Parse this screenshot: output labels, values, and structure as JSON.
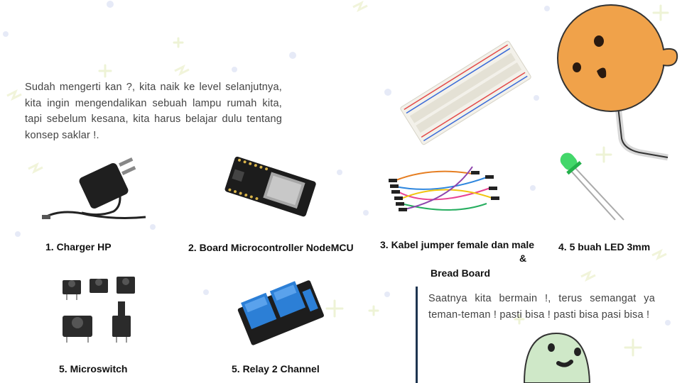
{
  "intro_text": "Sudah mengerti kan ?, kita naik ke level selanjutnya, kita ingin mengendalikan sebuah lampu rumah kita, tapi sebelum kesana, kita harus belajar dulu tentang konsep saklar !.",
  "components": [
    {
      "caption": "1. Charger HP",
      "icon": "phone-charger-icon"
    },
    {
      "caption": "2. Board Microcontroller NodeMCU",
      "icon": "nodemcu-board-icon"
    },
    {
      "caption": "3. Kabel jumper female dan male",
      "caption_amp": "&",
      "caption_extra": "Bread Board",
      "icon": "jumper-wires-icon"
    },
    {
      "caption": "4. 5 buah LED 3mm",
      "icon": "led-icon"
    },
    {
      "caption": "5. Microswitch",
      "icon": "push-button-icon"
    },
    {
      "caption": "5. Relay 2 Channel",
      "icon": "relay-module-icon"
    }
  ],
  "quote_text": "Saatnya kita bermain !, terus semangat ya teman-teman ! pasti bisa ! pasti bisa pasi bisa !",
  "colors": {
    "text": "#434343",
    "accent_bar": "#1e3550",
    "mascot_orange": "#f0a24a",
    "mascot_green": "#cfe8c8",
    "led_green": "#2fd35a"
  }
}
